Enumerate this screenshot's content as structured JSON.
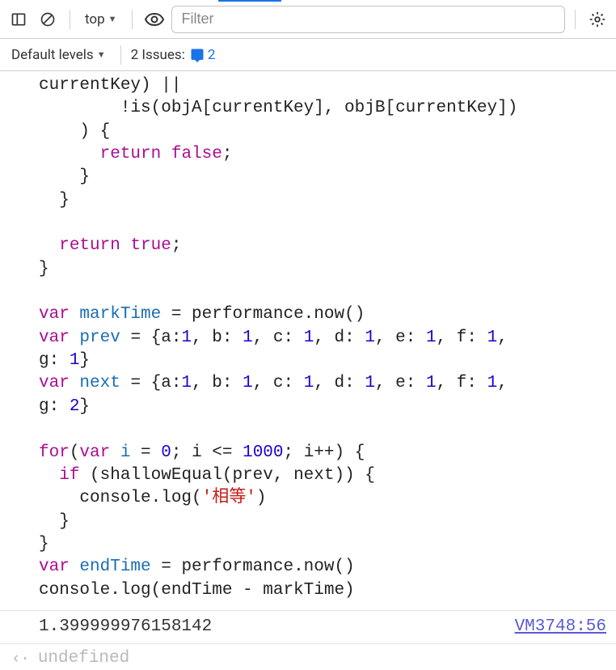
{
  "toolbar": {
    "context_label": "top",
    "filter_placeholder": "Filter"
  },
  "subbar": {
    "levels_label": "Default levels",
    "issues_label": "2 Issues:",
    "issues_count": "2"
  },
  "code": {
    "l1": "currentKey) ||",
    "l2a": "        !is(objA[currentKey], objB[currentKey])",
    "l2b": "    ) {",
    "l3a": "return",
    "l3b": " ",
    "l3c": "false",
    "l3d": ";",
    "l4": "    }",
    "l5": "  }",
    "l6": "",
    "l7a": "return",
    "l7b": " ",
    "l7c": "true",
    "l7d": ";",
    "l8": "}",
    "l9": "",
    "l10a": "var",
    "l10b": " ",
    "l10c": "markTime",
    "l10d": " = performance.now()",
    "l11a": "var",
    "l11b": " ",
    "l11c": "prev",
    "l11d": " = {a:",
    "l11e": "1",
    "l11f": ", b: ",
    "l11g": "1",
    "l11h": ", c: ",
    "l11i": "1",
    "l11j": ", d: ",
    "l11k": "1",
    "l11l": ", e: ",
    "l11m": "1",
    "l11n": ", f: ",
    "l11o": "1",
    "l11p": ",",
    "l12a": "g: ",
    "l12b": "1",
    "l12c": "}",
    "l13a": "var",
    "l13b": " ",
    "l13c": "next",
    "l13d": " = {a:",
    "l13e": "1",
    "l13f": ", b: ",
    "l13g": "1",
    "l13h": ", c: ",
    "l13i": "1",
    "l13j": ", d: ",
    "l13k": "1",
    "l13l": ", e: ",
    "l13m": "1",
    "l13n": ", f: ",
    "l13o": "1",
    "l13p": ",",
    "l14a": "g: ",
    "l14b": "2",
    "l14c": "}",
    "l15": "",
    "l16a": "for",
    "l16b": "(",
    "l16c": "var",
    "l16d": " ",
    "l16e": "i",
    "l16f": " = ",
    "l16g": "0",
    "l16h": "; i <= ",
    "l16i": "1000",
    "l16j": "; i++) {",
    "l17a": "  ",
    "l17b": "if",
    "l17c": " (shallowEqual(prev, next)) {",
    "l18a": "    console.log(",
    "l18b": "'相等'",
    "l18c": ")",
    "l19": "  }",
    "l20": "}",
    "l21a": "var",
    "l21b": " ",
    "l21c": "endTime",
    "l21d": " = performance.now()",
    "l22": "console.log(endTime - markTime)"
  },
  "output": {
    "value": "1.399999976158142",
    "source": "VM3748:56"
  },
  "return": {
    "value": "undefined"
  }
}
